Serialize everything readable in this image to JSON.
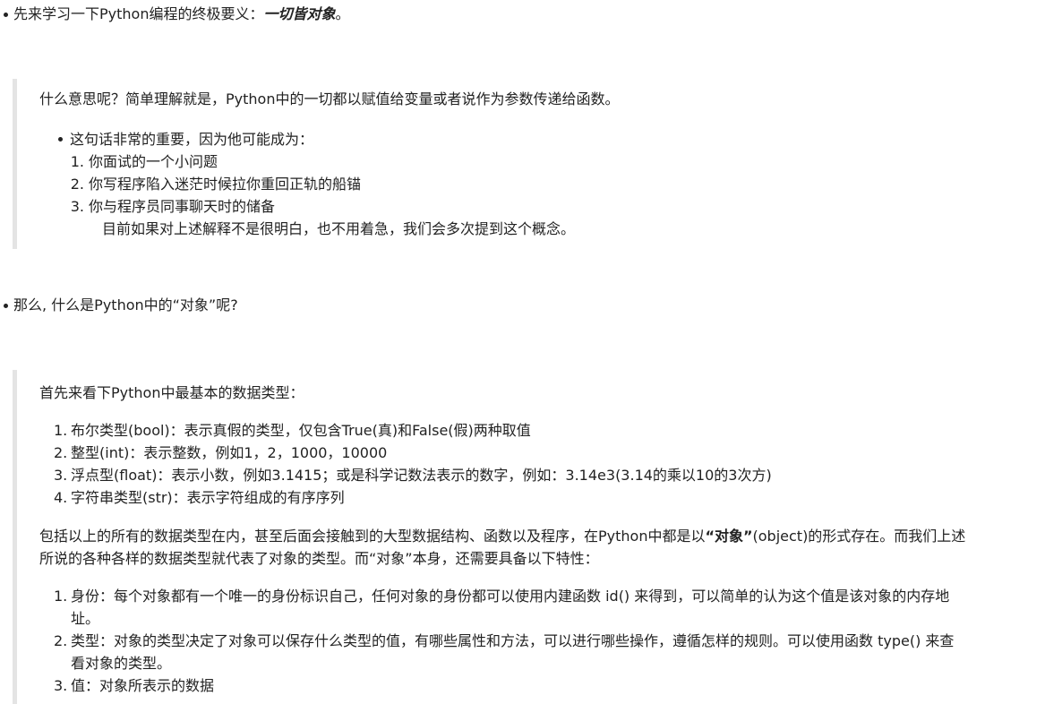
{
  "intro": {
    "text": "先来学习一下Python编程的终极要义：",
    "emphasis": "一切皆对象",
    "tail": "。"
  },
  "quote1": {
    "para": "什么意思呢？简单理解就是，Python中的一切都以赋值给变量或者说作为参数传递给函数。",
    "bullet": "这句话非常的重要，因为他可能成为：",
    "items": [
      "你面试的一个小问题",
      "你写程序陷入迷茫时候拉你重回正轨的船锚",
      "你与程序员同事聊天时的储备"
    ],
    "note": "目前如果对上述解释不是很明白，也不用着急，我们会多次提到这个概念。"
  },
  "question": "那么, 什么是Python中的“对象”呢?",
  "quote2": {
    "para": "首先来看下Python中最基本的数据类型：",
    "types": [
      "布尔类型(bool)：表示真假的类型，仅包含True(真)和False(假)两种取值",
      "整型(int)：表示整数，例如1，2，1000，10000",
      "浮点型(float)：表示小数，例如3.1415；或是科学记数法表示的数字，例如：3.14e3(3.14的乘以10的3次方)",
      "字符串类型(str)：表示字符组成的有序序列"
    ],
    "para2_a": "包括以上的所有的数据类型在内，甚至后面会接触到的大型数据结构、函数以及程序，在Python中都是以",
    "para2_bold": "“对象”",
    "para2_b": "(object)的形式存在。而我们上述",
    "para2_line2": "所说的各种各样的数据类型就代表了对象的类型。而“对象”本身，还需要具备以下特性：",
    "traits": [
      {
        "line1": "身份：每个对象都有一个唯一的身份标识自己，任何对象的身份都可以使用内建函数 id() 来得到，可以简单的认为这个值是该对象的内存地",
        "line2": "址。"
      },
      {
        "line1": "类型：对象的类型决定了对象可以保存什么类型的值，有哪些属性和方法，可以进行哪些操作，遵循怎样的规则。可以使用函数 type() 来查",
        "line2": "看对象的类型。"
      },
      {
        "line1": "值：对象所表示的数据",
        "line2": ""
      }
    ]
  }
}
